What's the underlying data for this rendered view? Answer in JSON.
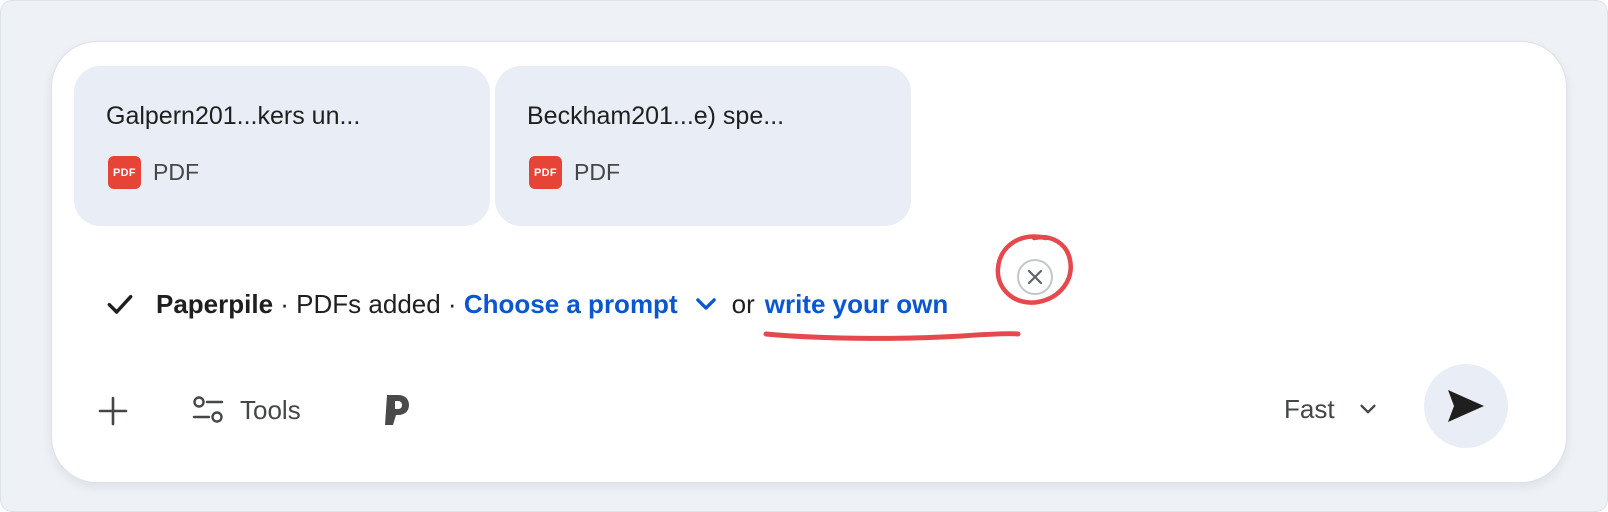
{
  "attachments": [
    {
      "title": "Galpern201...kers un...",
      "type_label": "PDF",
      "icon": "pdf-icon",
      "icon_text": "PDF"
    },
    {
      "title": "Beckham201...e) spe...",
      "type_label": "PDF",
      "icon": "pdf-icon",
      "icon_text": "PDF"
    }
  ],
  "status": {
    "icon": "check-icon",
    "source": "Paperpile",
    "separator1": " · ",
    "added_text": "PDFs added",
    "separator2": " · ",
    "choose_prompt_label": "Choose a prompt",
    "or_text": "or",
    "write_own_label": "write your own",
    "dismiss_icon": "close-icon"
  },
  "annotation_color": "#e5484d",
  "toolbar": {
    "add_icon": "plus-icon",
    "tools_icon": "tools-icon",
    "tools_label": "Tools",
    "paperpile_icon": "paperpile-p-icon",
    "model_label": "Fast",
    "model_chevron": "chevron-down-icon",
    "send_icon": "send-icon"
  },
  "colors": {
    "link": "#0b57d0",
    "chip_bg": "#e9eef6",
    "pdf_red": "#e64437",
    "page_bg": "#eef1f6"
  }
}
